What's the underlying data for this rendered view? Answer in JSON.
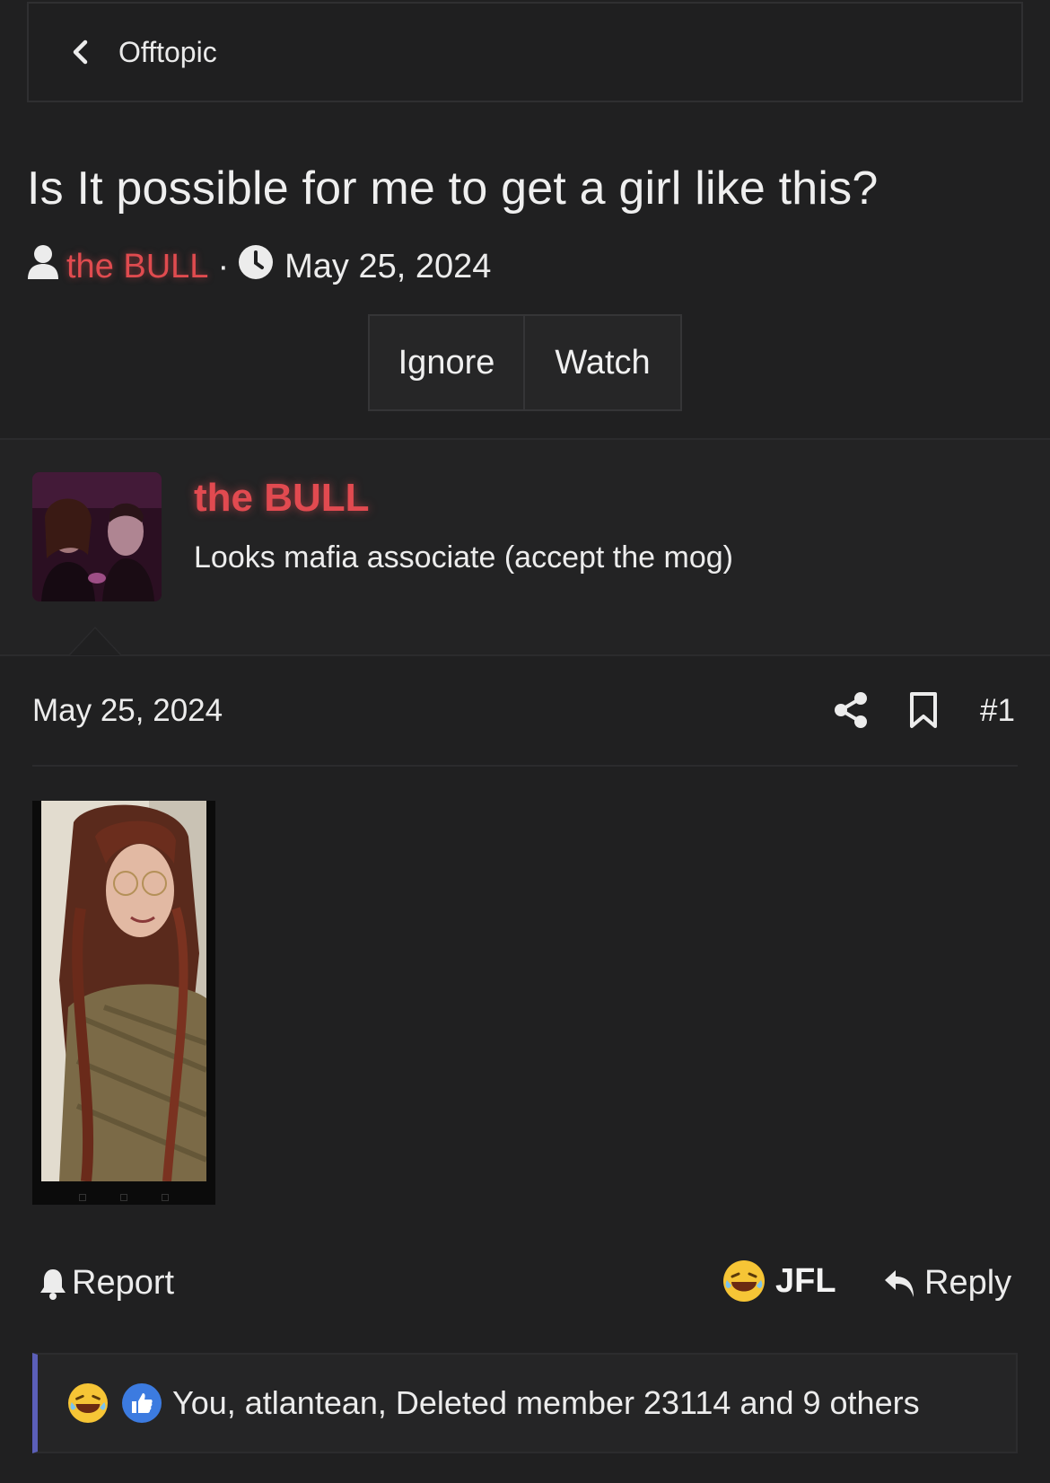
{
  "breadcrumb": {
    "label": "Offtopic",
    "icon": "chevron-left-icon"
  },
  "thread": {
    "title": "Is It possible for me to get a girl like this?",
    "author": "the BULL",
    "separator": "·",
    "date": "May 25, 2024"
  },
  "actions": {
    "ignore_label": "Ignore",
    "watch_label": "Watch"
  },
  "author_card": {
    "name": "the BULL",
    "user_title": "Looks mafia associate (accept the mog)"
  },
  "post": {
    "date": "May 25, 2024",
    "number": "#1",
    "icons": [
      "share-icon",
      "bookmark-icon"
    ]
  },
  "footer": {
    "report_label": "Report",
    "reaction_label": "JFL",
    "reply_label": "Reply"
  },
  "reactions": {
    "text": "You, atlantean, Deleted member 23114 and 9 others",
    "icons": [
      "laughing-emoji-icon",
      "thumbs-up-icon"
    ]
  },
  "colors": {
    "background": "#202021",
    "author_accent": "#e14a50",
    "reaction_bar_accent": "#5b5fb8",
    "like_blue": "#3c7be0"
  }
}
